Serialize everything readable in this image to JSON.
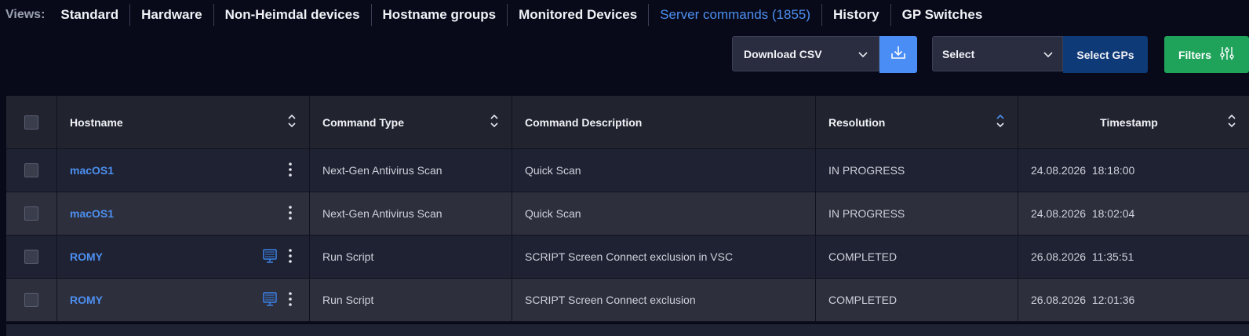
{
  "views": {
    "label": "Views:",
    "items": [
      {
        "label": "Standard",
        "active": false
      },
      {
        "label": "Hardware",
        "active": false
      },
      {
        "label": "Non-Heimdal devices",
        "active": false
      },
      {
        "label": "Hostname groups",
        "active": false
      },
      {
        "label": "Monitored Devices",
        "active": false
      },
      {
        "label": "Server commands (1855)",
        "active": true
      },
      {
        "label": "History",
        "active": false
      },
      {
        "label": "GP Switches",
        "active": false
      }
    ]
  },
  "toolbar": {
    "download_select_value": "Download CSV",
    "gp_select_value": "Select",
    "select_gps_label": "Select GPs",
    "filters_label": "Filters"
  },
  "table": {
    "columns": [
      "Hostname",
      "Command Type",
      "Command Description",
      "Resolution",
      "Timestamp"
    ],
    "rows": [
      {
        "hostname": "macOS1",
        "type": "Next-Gen Antivirus Scan",
        "desc": "Quick Scan",
        "resolution": "IN PROGRESS",
        "timestamp": "24.08.2026  18:18:00",
        "has_monitor": false
      },
      {
        "hostname": "macOS1",
        "type": "Next-Gen Antivirus Scan",
        "desc": "Quick Scan",
        "resolution": "IN PROGRESS",
        "timestamp": "24.08.2026  18:02:04",
        "has_monitor": false
      },
      {
        "hostname": "ROMY",
        "type": "Run Script",
        "desc": "SCRIPT Screen Connect exclusion in VSC",
        "resolution": "COMPLETED",
        "timestamp": "26.08.2026  11:35:51",
        "has_monitor": true
      },
      {
        "hostname": "ROMY",
        "type": "Run Script",
        "desc": "SCRIPT Screen Connect exclusion",
        "resolution": "COMPLETED",
        "timestamp": "26.08.2026  12:01:36",
        "has_monitor": true
      }
    ]
  },
  "colors": {
    "accent": "#4d8ff0",
    "download_button": "#4a8ef5",
    "select_gps_button": "#0f3a78",
    "filters_button": "#1fa35a",
    "background": "#080a1a"
  },
  "icons": {
    "download": "download-icon",
    "chevron": "chevron-down-icon",
    "filters": "sliders-icon",
    "sort": "sort-icon",
    "kebab": "kebab-menu-icon",
    "monitor": "monitor-icon"
  }
}
